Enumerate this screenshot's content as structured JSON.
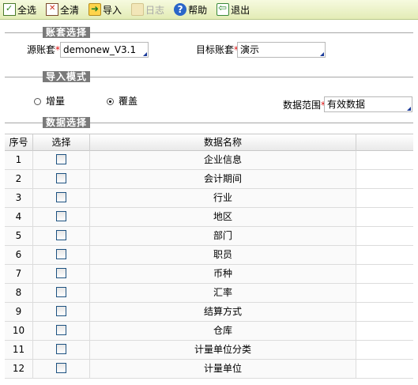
{
  "toolbar": {
    "buttons": [
      {
        "label": "全选",
        "icon": "select-all-icon",
        "enabled": true
      },
      {
        "label": "全清",
        "icon": "clear-all-icon",
        "enabled": true
      },
      {
        "label": "导入",
        "icon": "import-icon",
        "enabled": true
      },
      {
        "label": "日志",
        "icon": "log-icon",
        "enabled": false
      },
      {
        "label": "帮助",
        "icon": "help-icon",
        "enabled": true
      },
      {
        "label": "退出",
        "icon": "exit-icon",
        "enabled": true
      }
    ]
  },
  "account_section": {
    "title": "账套选择",
    "source_label": "源账套",
    "source_value": "demonew_V3.1",
    "target_label": "目标账套",
    "target_value": "演示"
  },
  "import_mode": {
    "title": "导入模式",
    "options": [
      {
        "label": "增量",
        "selected": false
      },
      {
        "label": "覆盖",
        "selected": true
      }
    ],
    "range_label": "数据范围",
    "range_value": "有效数据"
  },
  "data_select": {
    "title": "数据选择",
    "columns": {
      "no": "序号",
      "select": "选择",
      "name": "数据名称"
    },
    "rows": [
      {
        "no": "1",
        "name": "企业信息",
        "checked": false
      },
      {
        "no": "2",
        "name": "会计期间",
        "checked": false
      },
      {
        "no": "3",
        "name": "行业",
        "checked": false
      },
      {
        "no": "4",
        "name": "地区",
        "checked": false
      },
      {
        "no": "5",
        "name": "部门",
        "checked": false
      },
      {
        "no": "6",
        "name": "职员",
        "checked": false
      },
      {
        "no": "7",
        "name": "币种",
        "checked": false
      },
      {
        "no": "8",
        "name": "汇率",
        "checked": false
      },
      {
        "no": "9",
        "name": "结算方式",
        "checked": false
      },
      {
        "no": "10",
        "name": "仓库",
        "checked": false
      },
      {
        "no": "11",
        "name": "计量单位分类",
        "checked": false
      },
      {
        "no": "12",
        "name": "计量单位",
        "checked": false
      }
    ]
  },
  "colors": {
    "toolbar_bg": "#e3ecb6",
    "group_label_bg": "#7a7a7a",
    "required_mark": "#e01010",
    "combo_arrow": "#1a3a9a"
  }
}
